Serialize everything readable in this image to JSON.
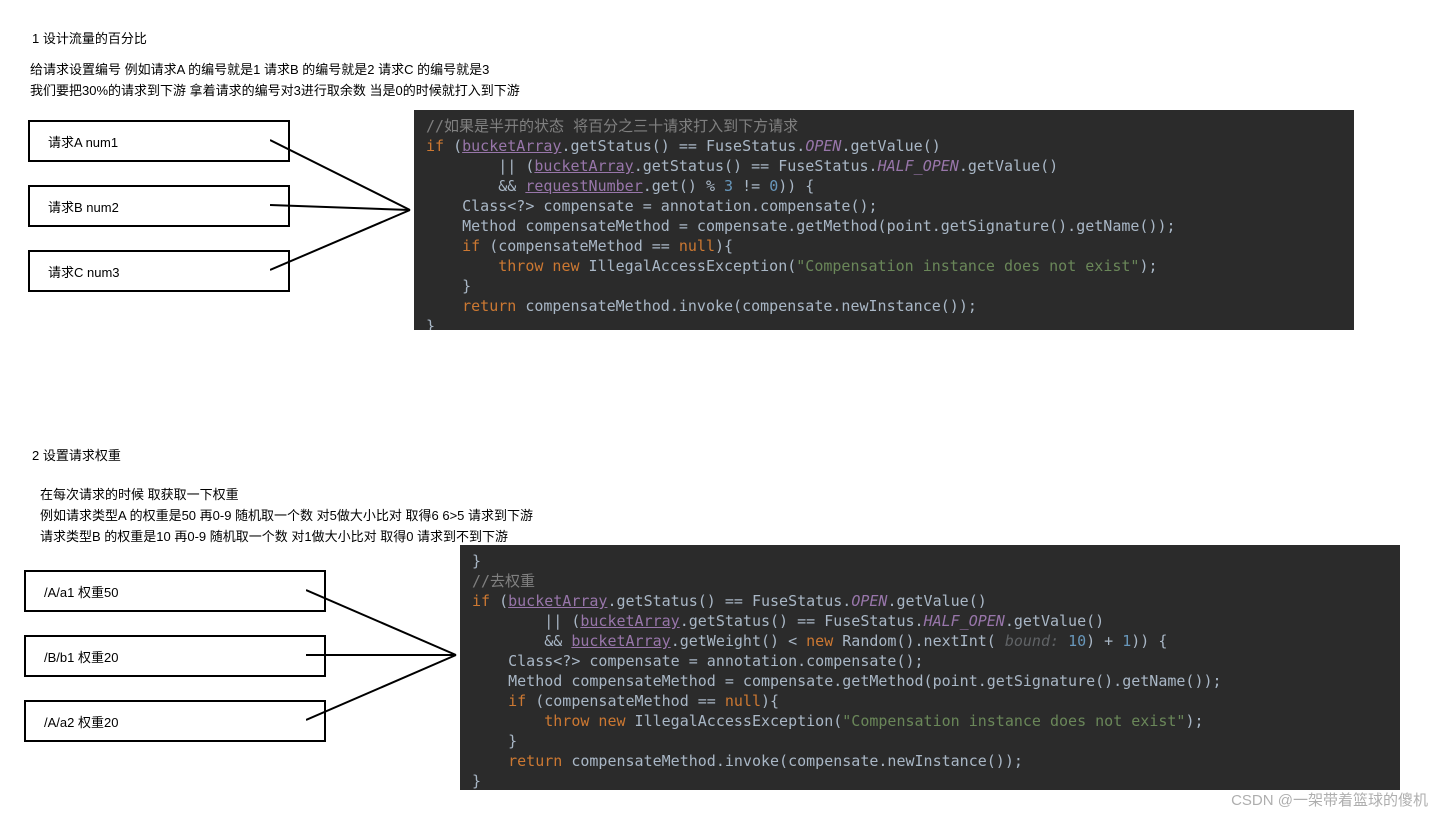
{
  "section1": {
    "title": "1 设计流量的百分比",
    "desc_line1": "给请求设置编号 例如请求A 的编号就是1 请求B 的编号就是2 请求C 的编号就是3",
    "desc_line2": "  我们要把30%的请求到下游 拿着请求的编号对3进行取余数 当是0的时候就打入到下游",
    "boxes": [
      "请求A num1",
      "请求B num2",
      "请求C num3"
    ]
  },
  "code1": {
    "l1_comment": "//如果是半开的状态 将百分之三十请求打入到下方请求",
    "l2": {
      "kw_if": "if",
      "p1": " (",
      "var": "bucketArray",
      "m": ".getStatus() == FuseStatus.",
      "c": "OPEN",
      "m2": ".getValue()"
    },
    "l3": {
      "op": "|| (",
      "var": "bucketArray",
      "m": ".getStatus() == FuseStatus.",
      "c": "HALF_OPEN",
      "m2": ".getValue()"
    },
    "l4": {
      "op": "&& ",
      "var": "requestNumber",
      "m": ".get() % ",
      "n1": "3",
      "m2": " != ",
      "n2": "0",
      "p": ")) {"
    },
    "l5": {
      "t": "Class<?> compensate = annotation.compensate();"
    },
    "l6": {
      "t": "Method compensateMethod = compensate.getMethod(point.getSignature().getName());"
    },
    "l7": {
      "kw": "if",
      "p": " (compensateMethod == ",
      "nul": "null",
      "p2": "){"
    },
    "l8": {
      "kw": "throw new",
      "cls": " IllegalAccessException(",
      "str": "\"Compensation instance does not exist\"",
      "p": ");"
    },
    "l9": {
      "p": "}"
    },
    "l10": {
      "kw": "return",
      "m": " compensateMethod.invoke(compensate.newInstance());"
    },
    "l11": {
      "p": "}"
    }
  },
  "section2": {
    "title": "2 设置请求权重",
    "desc_line1": "在每次请求的时候 取获取一下权重",
    "desc_line2": "  例如请求类型A 的权重是50 再0-9 随机取一个数 对5做大小比对 取得6 6>5 请求到下游",
    "desc_line3": "      请求类型B 的权重是10 再0-9 随机取一个数 对1做大小比对 取得0 请求到不到下游",
    "boxes": [
      "/A/a1 权重50",
      "/B/b1   权重20",
      "/A/a2   权重20"
    ]
  },
  "code2": {
    "l0": {
      "p": "}"
    },
    "l1_comment": "//去权重",
    "l2": {
      "kw_if": "if",
      "p1": " (",
      "var": "bucketArray",
      "m": ".getStatus() == FuseStatus.",
      "c": "OPEN",
      "m2": ".getValue()"
    },
    "l3": {
      "op": "|| (",
      "var": "bucketArray",
      "m": ".getStatus() == FuseStatus.",
      "c": "HALF_OPEN",
      "m2": ".getValue()"
    },
    "l4": {
      "op": "&& ",
      "var": "bucketArray",
      "m": ".getWeight() < ",
      "kw": "new",
      "m2": " Random().nextInt(",
      "hint": " bound: ",
      "n": "10",
      "m3": ") + ",
      "n2": "1",
      "p": ")) {"
    },
    "l5": {
      "t": "Class<?> compensate = annotation.compensate();"
    },
    "l6": {
      "t": "Method compensateMethod = compensate.getMethod(point.getSignature().getName());"
    },
    "l7": {
      "kw": "if",
      "p": " (compensateMethod == ",
      "nul": "null",
      "p2": "){"
    },
    "l8": {
      "kw": "throw new",
      "cls": " IllegalAccessException(",
      "str": "\"Compensation instance does not exist\"",
      "p": ");"
    },
    "l9": {
      "p": "}"
    },
    "l10": {
      "kw": "return",
      "m": " compensateMethod.invoke(compensate.newInstance());"
    },
    "l11": {
      "p": "}"
    }
  },
  "watermark": "CSDN @一架带着篮球的傻机"
}
